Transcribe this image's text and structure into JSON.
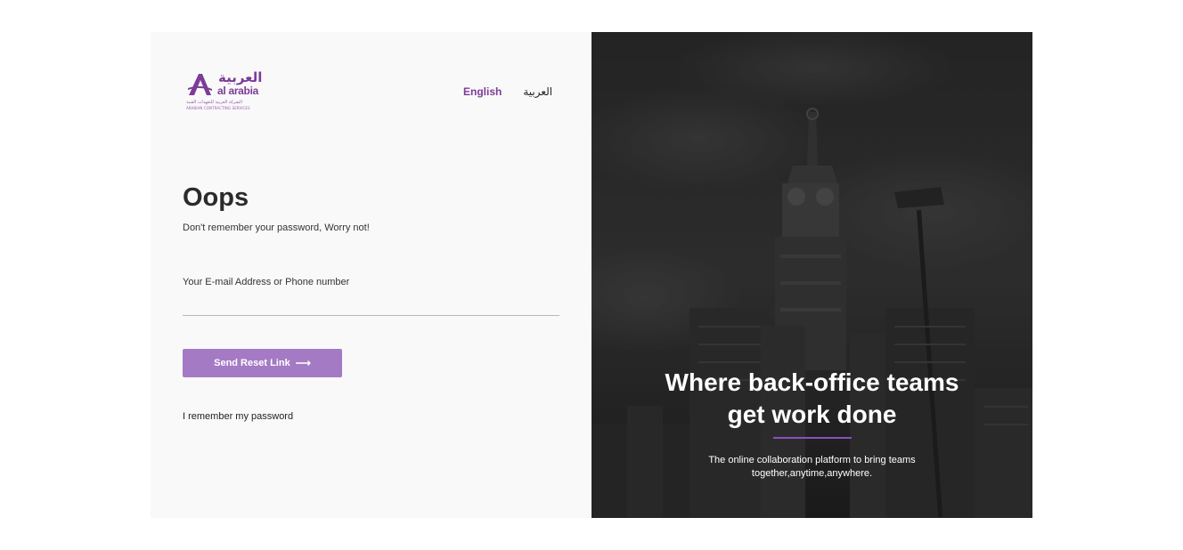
{
  "brand": {
    "name_ar": "العربية",
    "name_en": "al arabia",
    "tagline_ar": "الشركة العربية للتعهدات الفنية",
    "tagline_en": "ARABIAN CONTRACTING SERVICES",
    "accent": "#7d3c98"
  },
  "language": {
    "english": "English",
    "arabic": "العربية"
  },
  "form": {
    "title": "Oops",
    "subtitle": "Don't remember your password, Worry not!",
    "field_label": "Your E-mail Address or Phone number",
    "field_value": "",
    "submit_label": "Send Reset Link",
    "submit_icon": "arrow-right-icon",
    "submit_color": "#a57ac4",
    "back_link": "I remember my password"
  },
  "hero": {
    "title_line1": "Where back-office teams",
    "title_line2": "get work done",
    "text_line1": "The online collaboration platform to bring teams",
    "text_line2": "together,anytime,anywhere.",
    "divider_color": "#8a4fc0"
  }
}
